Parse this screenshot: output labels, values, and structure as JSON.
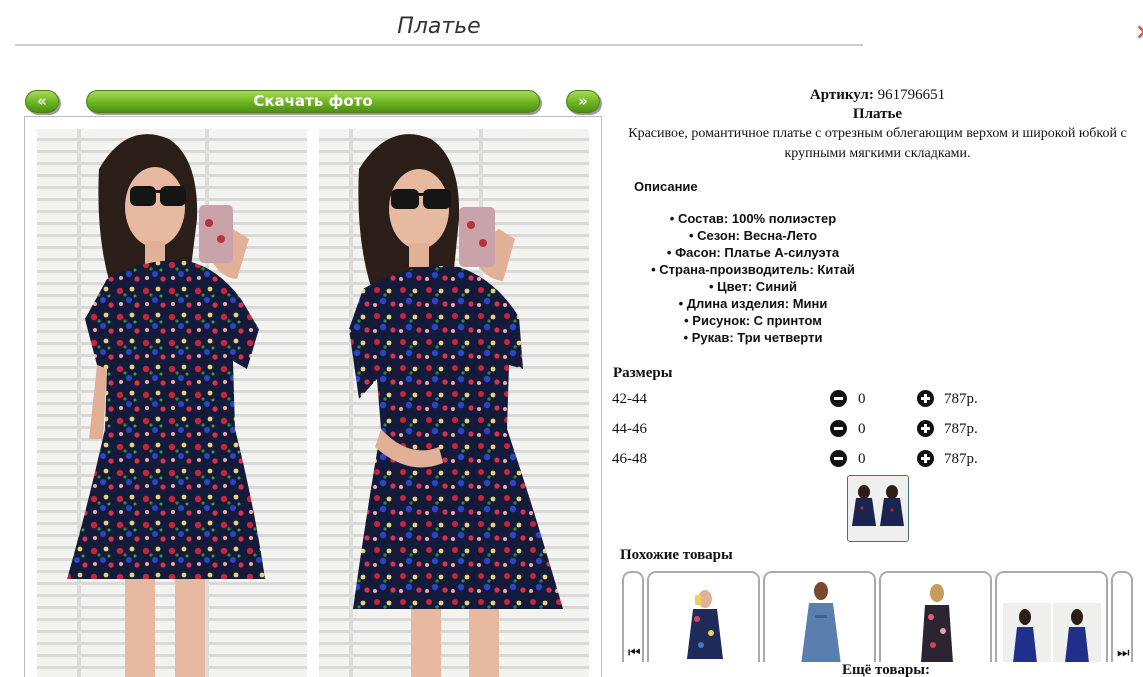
{
  "page": {
    "title": "Платье",
    "close_glyph": "×"
  },
  "gallery": {
    "prev_label": "«",
    "download_label": "Скачать фото",
    "next_label": "»"
  },
  "product": {
    "article_label": "Артикул:",
    "article_value": "961796651",
    "name": "Платье",
    "description": "Красивое, романтичное платье с отрезным облегающим верхом и широкой юбкой с крупными мягкими складками."
  },
  "specs": {
    "title": "Описание",
    "items": [
      "Состав: 100% полиэстер",
      "Сезон: Весна-Лето",
      "Фасон: Платье А-силуэта",
      "Страна-производитель: Китай",
      "Цвет: Синий",
      "Длина изделия: Мини",
      "Рисунок: С принтом",
      "Рукав: Три четверти"
    ]
  },
  "sizes": {
    "title": "Размеры",
    "rows": [
      {
        "size": "42-44",
        "qty": "0",
        "price": "787р."
      },
      {
        "size": "44-46",
        "qty": "0",
        "price": "787р."
      },
      {
        "size": "46-48",
        "qty": "0",
        "price": "787р."
      }
    ]
  },
  "similar": {
    "title": "Похожие товары",
    "prev_icon": "⏮",
    "next_icon": "⏭",
    "more_label": "Ещё товары:"
  },
  "colors": {
    "button_green": "#6cb321",
    "accent_red": "#d9534f"
  }
}
